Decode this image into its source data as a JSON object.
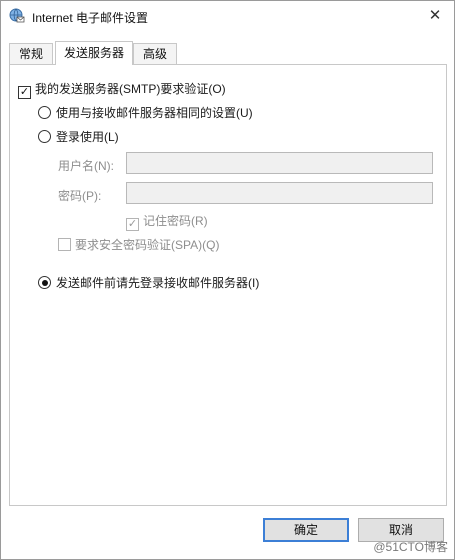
{
  "window": {
    "title": "Internet 电子邮件设置",
    "icon": "globe-mail-icon",
    "close_glyph": "✕"
  },
  "tabs": [
    {
      "label": "常规",
      "active": false
    },
    {
      "label": "发送服务器",
      "active": true
    },
    {
      "label": "高级",
      "active": false
    }
  ],
  "outgoing": {
    "smtp_auth": {
      "label": "我的发送服务器(SMTP)要求验证(O)",
      "checked": true
    },
    "same_as_incoming": {
      "label": "使用与接收邮件服务器相同的设置(U)",
      "selected": false
    },
    "log_on_using": {
      "label": "登录使用(L)",
      "selected": false
    },
    "username": {
      "label": "用户名(N):",
      "value": ""
    },
    "password": {
      "label": "密码(P):",
      "value": ""
    },
    "remember_password": {
      "label": "记住密码(R)",
      "checked": true,
      "enabled": false
    },
    "spa": {
      "label": "要求安全密码验证(SPA)(Q)",
      "checked": false,
      "enabled": false
    },
    "log_on_incoming_first": {
      "label": "发送邮件前请先登录接收邮件服务器(I)",
      "selected": true
    }
  },
  "buttons": {
    "ok": "确定",
    "cancel": "取消"
  },
  "watermark": "@51CTO博客",
  "colors": {
    "default_button_border": "#3c7fd6",
    "disabled_text": "#8e8e8e"
  }
}
